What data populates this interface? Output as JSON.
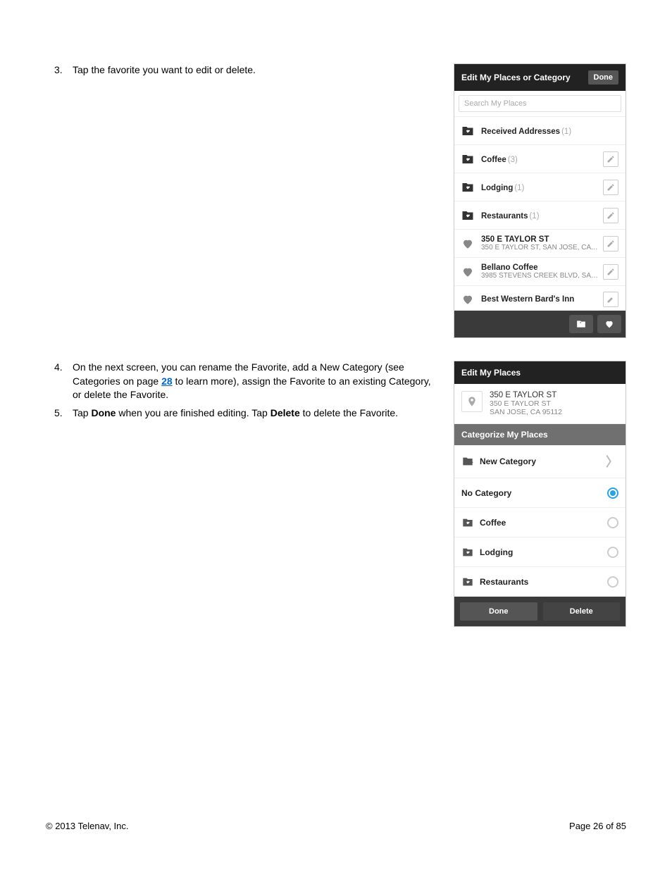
{
  "instructions": {
    "items": [
      {
        "num": "3.",
        "text_before": "Tap the favorite you want to edit or delete."
      },
      {
        "num": "4.",
        "text_before": "On the next screen, you can rename the Favorite, add a New Category (see Categories on page ",
        "link": "28",
        "text_after": " to learn more), assign the Favorite to an existing Category, or delete the Favorite."
      },
      {
        "num": "5.",
        "text_before": "Tap ",
        "bold1": "Done",
        "mid": " when you are finished editing. Tap ",
        "bold2": "Delete",
        "text_after2": " to delete the Favorite."
      }
    ]
  },
  "screen1": {
    "title": "Edit My Places or Category",
    "done": "Done",
    "search_placeholder": "Search My Places",
    "categories": [
      {
        "name": "Received Addresses",
        "count": "(1)",
        "edit": false
      },
      {
        "name": "Coffee",
        "count": "(3)",
        "edit": true
      },
      {
        "name": "Lodging",
        "count": "(1)",
        "edit": true
      },
      {
        "name": "Restaurants",
        "count": "(1)",
        "edit": true
      }
    ],
    "favorites": [
      {
        "title": "350 E TAYLOR ST",
        "sub": "350 E TAYLOR ST, SAN JOSE, CA 9..."
      },
      {
        "title": "Bellano Coffee",
        "sub": "3985 STEVENS CREEK BLVD, SAN..."
      },
      {
        "title": "Best Western Bard's Inn",
        "sub": ""
      }
    ]
  },
  "screen2": {
    "title": "Edit My Places",
    "place": {
      "name": "350 E TAYLOR ST",
      "line1": "350 E TAYLOR ST",
      "line2": "SAN JOSE, CA 95112"
    },
    "section": "Categorize My Places",
    "new_category": "New Category",
    "selected": "No Category",
    "options": [
      {
        "label": "No Category",
        "selected": true,
        "icon": "none"
      },
      {
        "label": "Coffee",
        "selected": false,
        "icon": "folder"
      },
      {
        "label": "Lodging",
        "selected": false,
        "icon": "folder"
      },
      {
        "label": "Restaurants",
        "selected": false,
        "icon": "folder"
      }
    ],
    "done": "Done",
    "delete": "Delete"
  },
  "footer": {
    "copyright": "© 2013 Telenav, Inc.",
    "page": "Page 26 of 85"
  }
}
